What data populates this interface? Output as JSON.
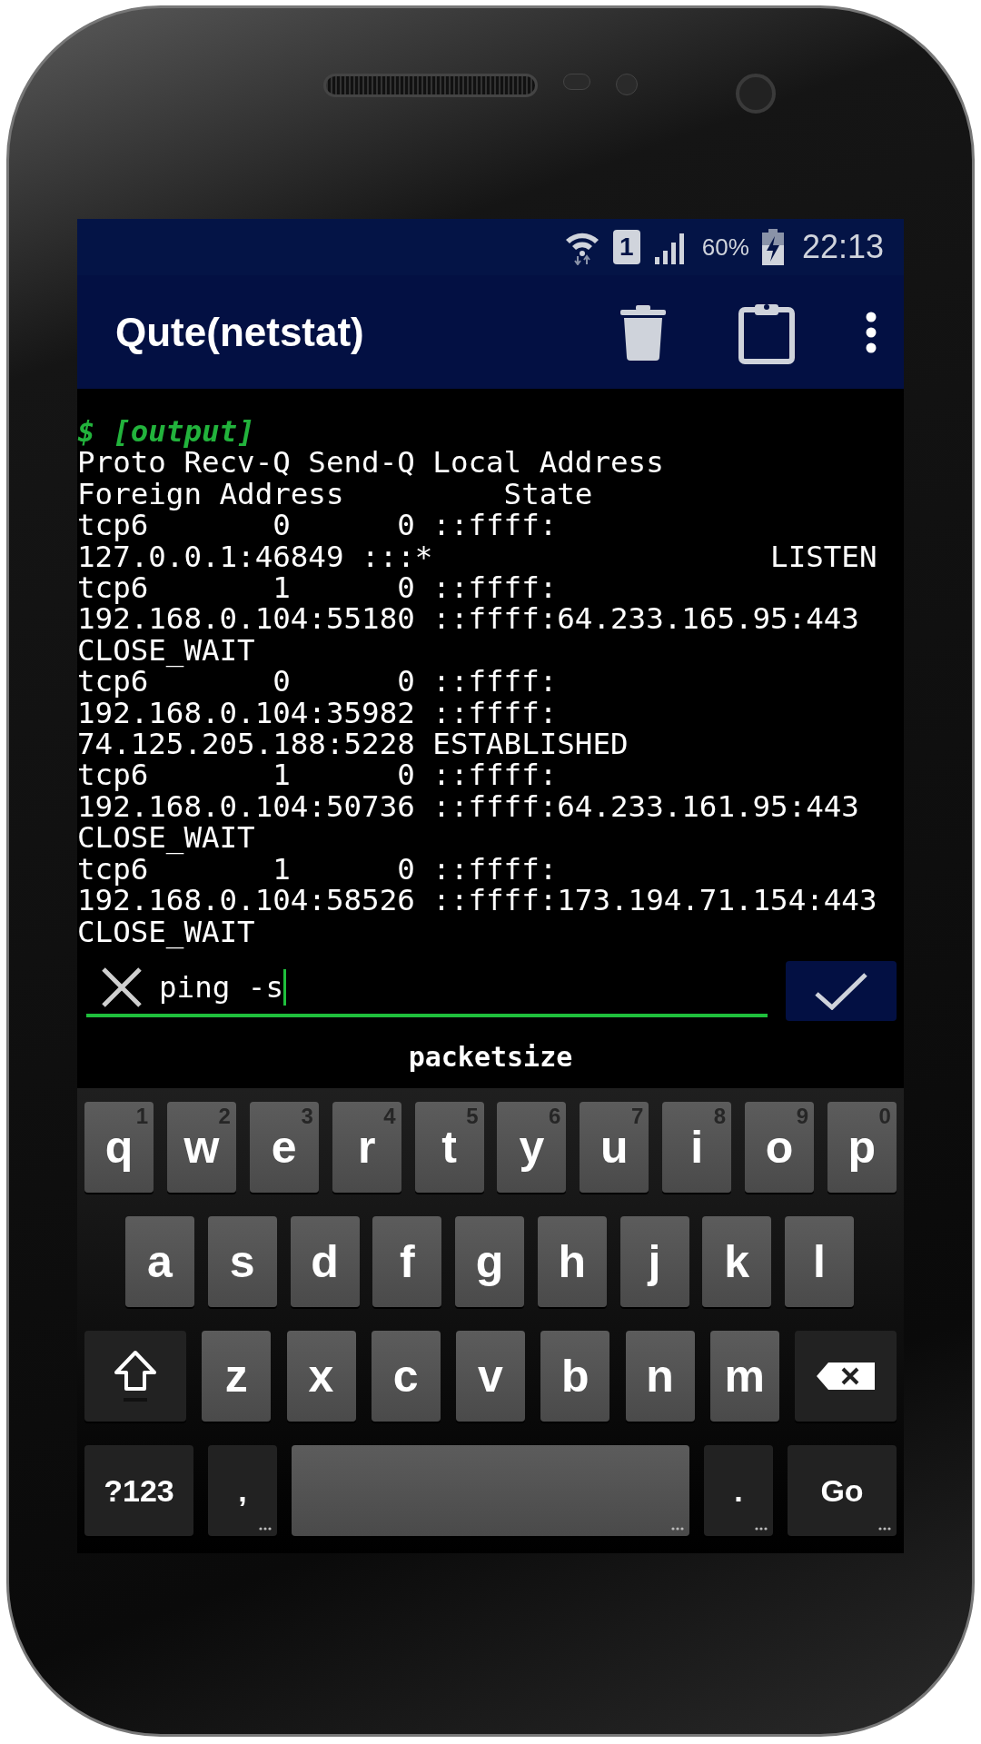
{
  "status_bar": {
    "sim": "1",
    "battery": "60%",
    "time": "22:13"
  },
  "app_bar": {
    "title": "Qute(netstat)"
  },
  "terminal": {
    "prompt": "$ [output]",
    "lines": [
      "Proto Recv-Q Send-Q Local Address",
      "Foreign Address         State",
      "tcp6       0      0 ::ffff:",
      "127.0.0.1:46849 :::*                   LISTEN",
      "tcp6       1      0 ::ffff:",
      "192.168.0.104:55180 ::ffff:64.233.165.95:443",
      "CLOSE_WAIT",
      "tcp6       0      0 ::ffff:",
      "192.168.0.104:35982 ::ffff:",
      "74.125.205.188:5228 ESTABLISHED",
      "tcp6       1      0 ::ffff:",
      "192.168.0.104:50736 ::ffff:64.233.161.95:443",
      "CLOSE_WAIT",
      "tcp6       1      0 ::ffff:",
      "192.168.0.104:58526 ::ffff:173.194.71.154:443",
      "CLOSE_WAIT"
    ]
  },
  "command_input": {
    "value": "ping -s"
  },
  "suggestion": "packetsize",
  "keyboard": {
    "rows": [
      {
        "keys": [
          {
            "kind": "letter",
            "label": "q",
            "hint": "1"
          },
          {
            "kind": "letter",
            "label": "w",
            "hint": "2"
          },
          {
            "kind": "letter",
            "label": "e",
            "hint": "3"
          },
          {
            "kind": "letter",
            "label": "r",
            "hint": "4"
          },
          {
            "kind": "letter",
            "label": "t",
            "hint": "5"
          },
          {
            "kind": "letter",
            "label": "y",
            "hint": "6"
          },
          {
            "kind": "letter",
            "label": "u",
            "hint": "7"
          },
          {
            "kind": "letter",
            "label": "i",
            "hint": "8"
          },
          {
            "kind": "letter",
            "label": "o",
            "hint": "9"
          },
          {
            "kind": "letter",
            "label": "p",
            "hint": "0"
          }
        ]
      },
      {
        "keys": [
          {
            "kind": "letter",
            "label": "a"
          },
          {
            "kind": "letter",
            "label": "s"
          },
          {
            "kind": "letter",
            "label": "d"
          },
          {
            "kind": "letter",
            "label": "f"
          },
          {
            "kind": "letter",
            "label": "g"
          },
          {
            "kind": "letter",
            "label": "h"
          },
          {
            "kind": "letter",
            "label": "j"
          },
          {
            "kind": "letter",
            "label": "k"
          },
          {
            "kind": "letter",
            "label": "l"
          }
        ]
      },
      {
        "keys": [
          {
            "kind": "shift"
          },
          {
            "kind": "letter",
            "label": "z"
          },
          {
            "kind": "letter",
            "label": "x"
          },
          {
            "kind": "letter",
            "label": "c"
          },
          {
            "kind": "letter",
            "label": "v"
          },
          {
            "kind": "letter",
            "label": "b"
          },
          {
            "kind": "letter",
            "label": "n"
          },
          {
            "kind": "letter",
            "label": "m"
          },
          {
            "kind": "backspace"
          }
        ]
      },
      {
        "keys": [
          {
            "kind": "symbols",
            "label": "?123"
          },
          {
            "kind": "punct",
            "label": ",",
            "more": true
          },
          {
            "kind": "space",
            "more": true
          },
          {
            "kind": "punct",
            "label": ".",
            "more": true
          },
          {
            "kind": "action",
            "label": "Go",
            "more": true
          }
        ]
      }
    ]
  }
}
